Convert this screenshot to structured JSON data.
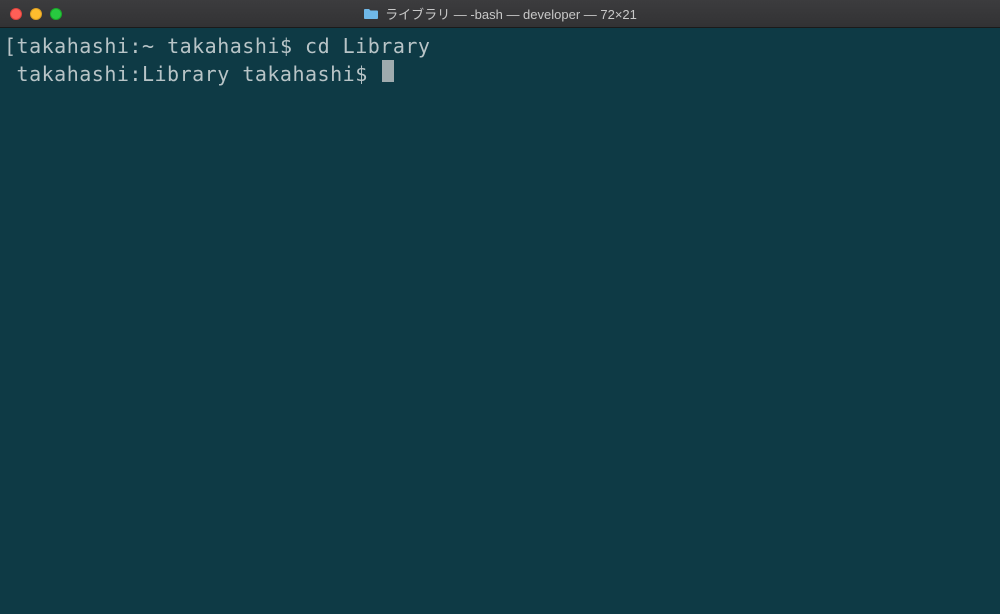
{
  "titlebar": {
    "title": "ライブラリ — -bash — developer — 72×21"
  },
  "terminal": {
    "lines": [
      {
        "prompt_open": "[",
        "host": "takahashi",
        "sep1": ":",
        "path": "~",
        "space1": " ",
        "user": "takahashi",
        "dollar": "$ ",
        "command": "cd Library"
      },
      {
        "prompt_open": " ",
        "host": "takahashi",
        "sep1": ":",
        "path": "Library",
        "space1": " ",
        "user": "takahashi",
        "dollar": "$ ",
        "command": ""
      }
    ]
  }
}
